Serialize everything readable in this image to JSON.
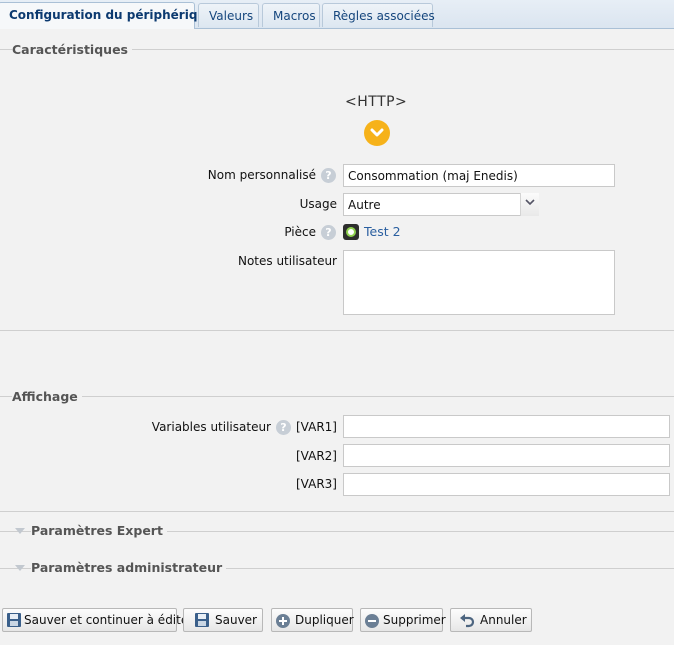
{
  "tabs": [
    {
      "label": "Configuration du périphérique",
      "active": true
    },
    {
      "label": "Valeurs",
      "active": false
    },
    {
      "label": "Macros",
      "active": false
    },
    {
      "label": "Règles associées",
      "active": false
    }
  ],
  "characteristics": {
    "legend": "Caractéristiques",
    "device_type": "<HTTP>",
    "name_label": "Nom personnalisé",
    "name_value": "Consommation (maj Enedis)",
    "usage_label": "Usage",
    "usage_value": "Autre",
    "room_label": "Pièce",
    "room_value": "Test 2",
    "notes_label": "Notes utilisateur",
    "notes_value": ""
  },
  "display": {
    "legend": "Affichage",
    "vars_label": "Variables utilisateur",
    "vars": [
      {
        "name": "[VAR1]",
        "value": ""
      },
      {
        "name": "[VAR2]",
        "value": ""
      },
      {
        "name": "[VAR3]",
        "value": ""
      }
    ]
  },
  "expert": {
    "title": "Paramètres Expert"
  },
  "admin": {
    "title": "Paramètres administrateur"
  },
  "buttons": {
    "save_continue": "Sauver et continuer à éditer",
    "save": "Sauver",
    "duplicate": "Dupliquer",
    "delete": "Supprimer",
    "cancel": "Annuler"
  },
  "icons": {
    "help": "question-mark-icon",
    "expand": "chevron-down-icon",
    "room": "room-icon",
    "save": "floppy-disk-icon",
    "duplicate": "plus-circle-icon",
    "delete": "minus-circle-icon",
    "cancel": "undo-arrow-icon"
  },
  "colors": {
    "accent": "#f6b21a",
    "link": "#2a5fa0",
    "tab_text": "#15467d"
  }
}
